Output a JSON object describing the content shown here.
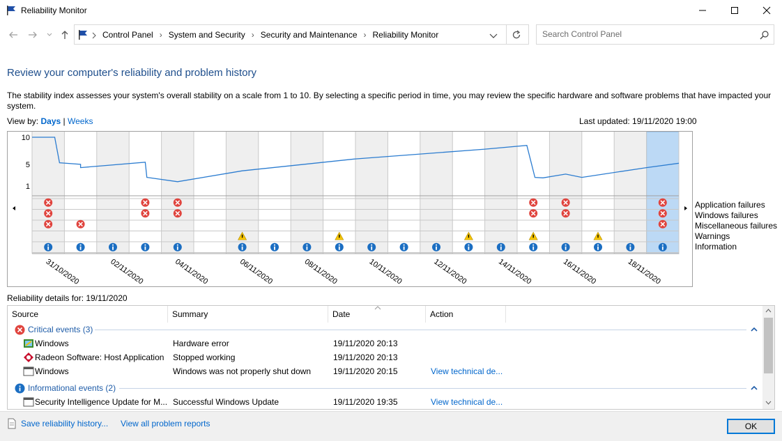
{
  "window": {
    "title": "Reliability Monitor"
  },
  "nav": {
    "breadcrumbs": [
      "Control Panel",
      "System and Security",
      "Security and Maintenance",
      "Reliability Monitor"
    ],
    "search_placeholder": "Search Control Panel"
  },
  "page": {
    "heading": "Review your computer's reliability and problem history",
    "description": "The stability index assesses your system's overall stability on a scale from 1 to 10. By selecting a specific period in time, you may review the specific hardware and software problems that have impacted your system.",
    "view_by_label": "View by:",
    "view_days": "Days",
    "view_sep": "|",
    "view_weeks": "Weeks",
    "last_updated": "Last updated: 19/11/2020 19:00"
  },
  "chart_data": {
    "type": "line",
    "ylim": [
      1,
      10
    ],
    "yticks": [
      "10",
      "5",
      "1"
    ],
    "columns": 20,
    "selected_column": 19,
    "x_labels": [
      "31/10/2020",
      "02/11/2020",
      "04/11/2020",
      "06/11/2020",
      "08/11/2020",
      "10/11/2020",
      "12/11/2020",
      "14/11/2020",
      "16/11/2020",
      "18/11/2020"
    ],
    "stability_points": [
      [
        0,
        10
      ],
      [
        0.7,
        10
      ],
      [
        0.85,
        5.3
      ],
      [
        1.5,
        5
      ],
      [
        1.5,
        4.4
      ],
      [
        3.5,
        5.4
      ],
      [
        3.55,
        2.6
      ],
      [
        4.5,
        1.8
      ],
      [
        6.5,
        3.8
      ],
      [
        10,
        6.0
      ],
      [
        14,
        7.8
      ],
      [
        15.3,
        8.5
      ],
      [
        15.55,
        2.6
      ],
      [
        15.8,
        2.5
      ],
      [
        16.5,
        3.2
      ],
      [
        17,
        2.6
      ],
      [
        19,
        4.4
      ],
      [
        20,
        5.2
      ]
    ],
    "legend": [
      "Application failures",
      "Windows failures",
      "Miscellaneous failures",
      "Warnings",
      "Information"
    ],
    "events": {
      "application_failures": [
        0,
        3,
        4,
        15,
        16,
        19
      ],
      "windows_failures": [
        0,
        3,
        4,
        15,
        16,
        19
      ],
      "misc_failures": [
        0,
        1,
        19
      ],
      "warnings": [
        6,
        9,
        13,
        15,
        17
      ],
      "information": [
        0,
        1,
        2,
        3,
        4,
        6,
        7,
        8,
        9,
        10,
        11,
        12,
        13,
        14,
        15,
        16,
        17,
        18,
        19
      ]
    }
  },
  "details": {
    "label": "Reliability details for: 19/11/2020",
    "columns": [
      "Source",
      "Summary",
      "Date",
      "Action"
    ],
    "groups": [
      {
        "title": "Critical events (3)",
        "rows": [
          {
            "source": "Windows",
            "summary": "Hardware error",
            "date": "19/11/2020 20:13",
            "action": ""
          },
          {
            "source": "Radeon Software: Host Application",
            "summary": "Stopped working",
            "date": "19/11/2020 20:13",
            "action": ""
          },
          {
            "source": "Windows",
            "summary": "Windows was not properly shut down",
            "date": "19/11/2020 20:15",
            "action": "View technical de..."
          }
        ]
      },
      {
        "title": "Informational events (2)",
        "rows": [
          {
            "source": "Security Intelligence Update for M...",
            "summary": "Successful Windows Update",
            "date": "19/11/2020 19:35",
            "action": "View technical de..."
          }
        ]
      }
    ]
  },
  "footer": {
    "save_link": "Save reliability history...",
    "view_reports_link": "View all problem reports",
    "ok_button": "OK"
  },
  "colors": {
    "accent": "#0078d7",
    "line": "#2b7cd0",
    "selected": "#bcd9f5",
    "error": "#e0443e",
    "warning": "#f5c400",
    "info": "#1b6ec2"
  }
}
